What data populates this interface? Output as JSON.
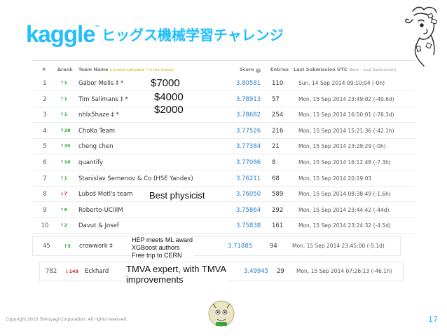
{
  "slide": {
    "logo": "kaggle",
    "title": "ヒッグス機械学習チャレンジ",
    "footer": "Copyright 2015 Shiroyagi Corporation. All rights reserved.",
    "page_number": "17"
  },
  "leaderboard": {
    "headers": {
      "rank": "#",
      "delta": "Δrank",
      "team": "Team Name",
      "team_note": "‡ model uploaded * in the money",
      "score": "Score",
      "entries": "Entries",
      "last": "Last Submission UTC",
      "last_note": "(Best – Last Submission)"
    },
    "rows": [
      {
        "rank": "1",
        "delta": "↑1",
        "team": "Gábor Melis ‡ *",
        "score": "3.80581",
        "entries": "110",
        "last": "Sun, 14 Sep 2014 09:10:04 (-0h)",
        "dir": "up"
      },
      {
        "rank": "2",
        "delta": "↑1",
        "team": "Tim Salimans ‡ *",
        "score": "3.78913",
        "entries": "57",
        "last": "Mon, 15 Sep 2014 23:49:02 (-40.6d)",
        "dir": "up"
      },
      {
        "rank": "3",
        "delta": "↑1",
        "team": "nhlx5haze ‡ *",
        "score": "3.78682",
        "entries": "254",
        "last": "Mon, 15 Sep 2014 16:50:01 (-76.3d)",
        "dir": "up"
      },
      {
        "rank": "4",
        "delta": "↑38",
        "team": "ChoKo Team",
        "score": "3.77526",
        "entries": "216",
        "last": "Mon, 15 Sep 2014 15:21:36 (-42.1h)",
        "dir": "up"
      },
      {
        "rank": "5",
        "delta": "↑35",
        "team": "cheng chen",
        "score": "3.77384",
        "entries": "21",
        "last": "Mon, 15 Sep 2014 23:29:29 (-0h)",
        "dir": "up"
      },
      {
        "rank": "6",
        "delta": "↑16",
        "team": "quantify",
        "score": "3.77086",
        "entries": "8",
        "last": "Mon, 15 Sep 2014 16:12:48 (-7.3h)",
        "dir": "up"
      },
      {
        "rank": "7",
        "delta": "↑1",
        "team": "Stanislav Semenov & Co (HSE Yandex)",
        "score": "3.76211",
        "entries": "68",
        "last": "Mon, 15 Sep 2014 20:19:03",
        "dir": "up"
      },
      {
        "rank": "8",
        "delta": "↓7",
        "team": "Luboš Motl's team",
        "score": "3.76050",
        "entries": "589",
        "last": "Mon, 15 Sep 2014 08:38:49 (-1.6h)",
        "dir": "down"
      },
      {
        "rank": "9",
        "delta": "↑8",
        "team": "Roberto-UCIIIM",
        "score": "3.75864",
        "entries": "292",
        "last": "Mon, 15 Sep 2014 23:44:42 (-44d)",
        "dir": "up"
      },
      {
        "rank": "10",
        "delta": "↑2",
        "team": "Davut & Josef",
        "score": "3.75838",
        "entries": "161",
        "last": "Mon, 15 Sep 2014 23:24:32 (-4.5d)",
        "dir": "up"
      }
    ],
    "extra_rows": [
      {
        "rank": "45",
        "delta": "↑5",
        "team": "crowwork ‡",
        "score": "3.71885",
        "entries": "94",
        "last": "Mon, 15 Sep 2014 23:45:00 (-5.1d)",
        "dir": "up"
      },
      {
        "rank": "782",
        "delta": "↓149",
        "team": "Eckhard",
        "score": "3.49945",
        "entries": "29",
        "last": "Mon, 15 Sep 2014 07:26:13 (-46.1h)",
        "dir": "down"
      }
    ]
  },
  "annotations": {
    "prize1": "$7000",
    "prize2": "$4000",
    "prize3": "$2000",
    "physicist": "Best physicist",
    "crowwork_line1": "HEP meets ML award",
    "crowwork_line2": "XGBoost authors",
    "crowwork_line3": "Free trip to CERN",
    "eckhard_line1": "TMVA expert, with TMVA",
    "eckhard_line2": "improvements"
  },
  "colors": {
    "kaggle_blue": "#20beff",
    "score_blue": "#2a7fc7",
    "up": "#3aa33a",
    "down": "#d03030"
  }
}
